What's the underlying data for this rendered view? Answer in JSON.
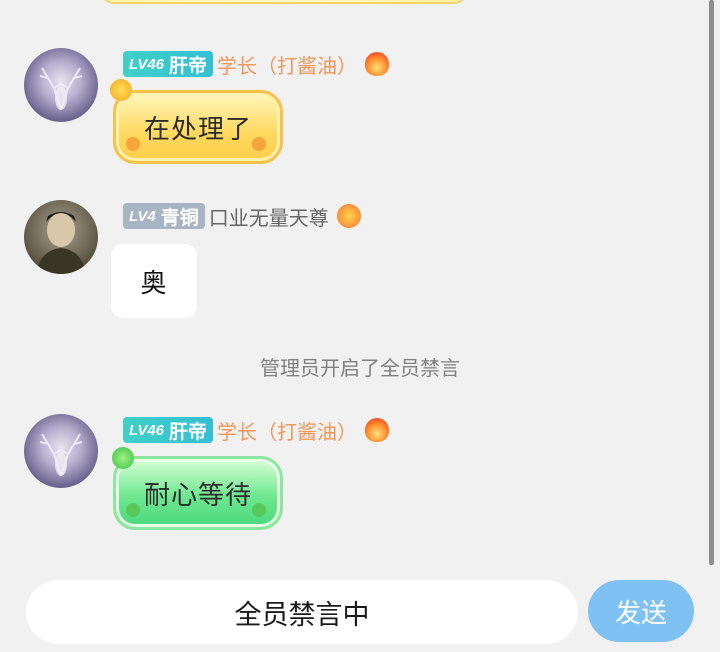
{
  "messages": [
    {
      "rank": "肝帝",
      "level": "LV46",
      "title": "学长（打酱油）",
      "text": "在处理了",
      "avatar": "deer-avatar",
      "badge": "fire-icon"
    },
    {
      "rank": "青铜",
      "level": "LV4",
      "title": "口业无量天尊",
      "text": "奥",
      "avatar": "man-avatar",
      "badge": "smile-icon"
    },
    {
      "rank": "肝帝",
      "level": "LV46",
      "title": "学长（打酱油）",
      "text": "耐心等待",
      "avatar": "deer-avatar",
      "badge": "fire-icon"
    }
  ],
  "system_notice": "管理员开启了全员禁言",
  "input": {
    "value": "全员禁言中"
  },
  "send_label": "发送",
  "colors": {
    "background": "#f1f1f1",
    "send_button": "#7ec1f2",
    "title_orange": "#f0965a",
    "level_teal": "#3fd1c8",
    "level_grey": "#a7b4c4",
    "notice_text": "#808080"
  }
}
